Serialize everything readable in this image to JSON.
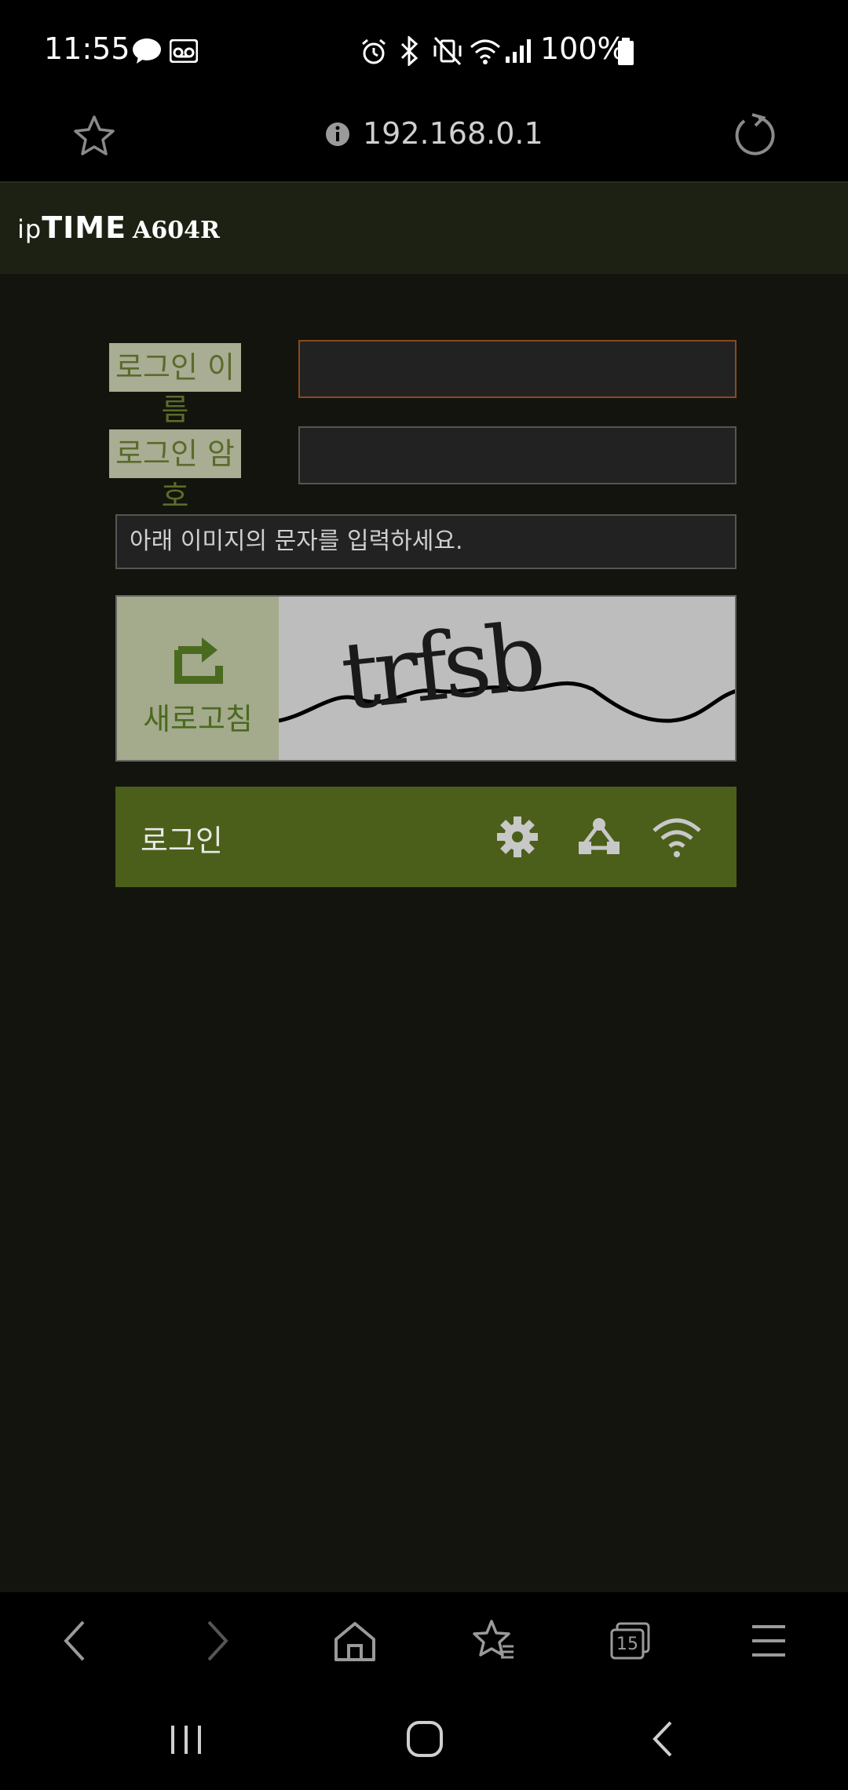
{
  "status_bar": {
    "time": "11:55",
    "battery": "100%"
  },
  "url_bar": {
    "url": "192.168.0.1"
  },
  "header": {
    "brand_ip": "ip",
    "brand_time": "TIME",
    "model": "A604R"
  },
  "login_form": {
    "username_label": "로그인 이름",
    "password_label": "로그인 암호",
    "username_value": "",
    "password_value": "",
    "captcha_placeholder": "아래 이미지의 문자를 입력하세요.",
    "captcha_text": "trfsb",
    "refresh_label": "새로고침",
    "login_label": "로그인"
  },
  "browser_nav": {
    "tabs_count": "15"
  },
  "colors": {
    "background": "#13140d",
    "header": "#1c2113",
    "accent_green": "#4b5f1a",
    "label_bg": "#a9ad94",
    "focus_border": "#8a4a1e"
  }
}
